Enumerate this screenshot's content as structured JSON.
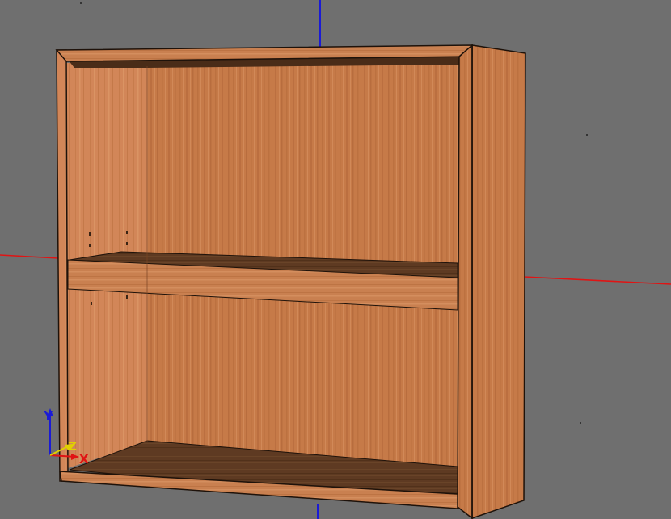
{
  "viewport": {
    "background_color": "#6f6f6f",
    "object": "cabinet"
  },
  "colors": {
    "x_axis": "#e01414",
    "y_axis": "#1a1ad6",
    "z_axis": "#e0d000",
    "wood_light": "#c87c4c",
    "wood_mid": "#b4693c",
    "wood_dark": "#5a3620",
    "edge": "#1e120a"
  },
  "gizmo": {
    "x_label": "X",
    "y_label": "Y",
    "z_label": "Z"
  }
}
